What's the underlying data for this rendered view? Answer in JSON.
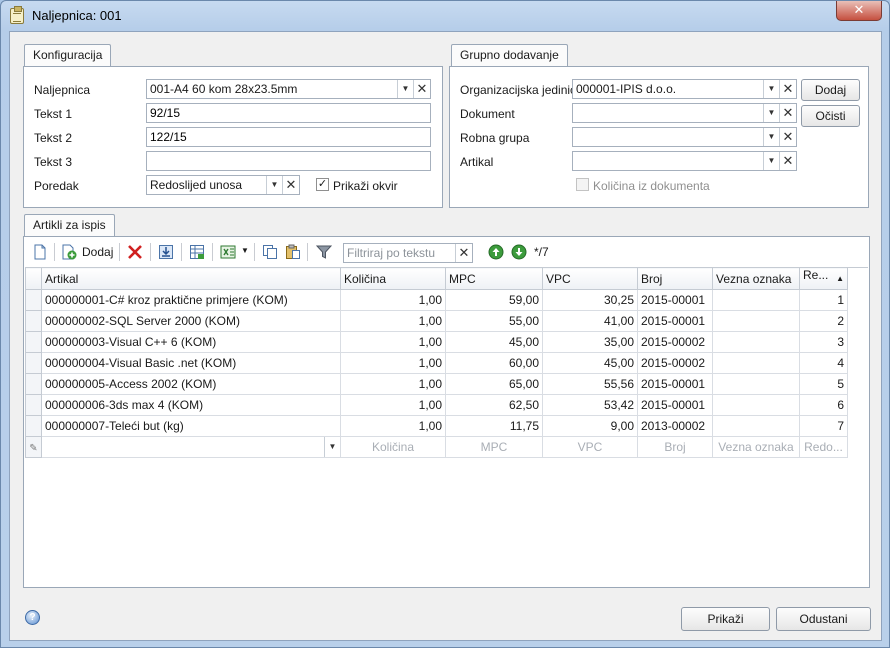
{
  "window": {
    "title": "Naljepnica: 001",
    "close_symbol": "✕"
  },
  "config": {
    "tab_label": "Konfiguracija",
    "naljepnica_label": "Naljepnica",
    "naljepnica_value": "001-A4 60 kom 28x23.5mm",
    "tekst1_label": "Tekst 1",
    "tekst1_value": "92/15",
    "tekst2_label": "Tekst 2",
    "tekst2_value": "122/15",
    "tekst3_label": "Tekst 3",
    "tekst3_value": "",
    "poredak_label": "Poredak",
    "poredak_value": "Redoslijed unosa",
    "prikazi_okvir_label": "Prikaži okvir",
    "prikazi_okvir_checked": true
  },
  "group": {
    "tab_label": "Grupno dodavanje",
    "org_label": "Organizacijska jedinica",
    "org_value": "000001-IPIS d.o.o.",
    "dokument_label": "Dokument",
    "dokument_value": "",
    "robna_label": "Robna grupa",
    "robna_value": "",
    "artikal_label": "Artikal",
    "artikal_value": "",
    "dodaj_label": "Dodaj",
    "ocisti_label": "Očisti",
    "kolicina_dok_label": "Količina iz dokumenta",
    "kolicina_dok_checked": false
  },
  "items": {
    "tab_label": "Artikli za ispis",
    "dodaj_label": "Dodaj",
    "filter_placeholder": "Filtriraj po tekstu",
    "count_label": "*/7",
    "columns": [
      "Artikal",
      "Količina",
      "MPC",
      "VPC",
      "Broj",
      "Vezna oznaka",
      "Re..."
    ],
    "sort_indicator": "▲",
    "rows": [
      [
        "000000001-C# kroz praktične primjere (KOM)",
        "1,00",
        "59,00",
        "30,25",
        "2015-00001",
        "",
        "1"
      ],
      [
        "000000002-SQL Server 2000 (KOM)",
        "1,00",
        "55,00",
        "41,00",
        "2015-00001",
        "",
        "2"
      ],
      [
        "000000003-Visual C++ 6 (KOM)",
        "1,00",
        "45,00",
        "35,00",
        "2015-00002",
        "",
        "3"
      ],
      [
        "000000004-Visual Basic .net (KOM)",
        "1,00",
        "60,00",
        "45,00",
        "2015-00002",
        "",
        "4"
      ],
      [
        "000000005-Access 2002 (KOM)",
        "1,00",
        "65,00",
        "55,56",
        "2015-00001",
        "",
        "5"
      ],
      [
        "000000006-3ds max 4 (KOM)",
        "1,00",
        "62,50",
        "53,42",
        "2015-00001",
        "",
        "6"
      ],
      [
        "000000007-Teleći but (kg)",
        "1,00",
        "11,75",
        "9,00",
        "2013-00002",
        "",
        "7"
      ]
    ],
    "new_row_placeholders": [
      "Količina",
      "MPC",
      "VPC",
      "Broj",
      "Vezna oznaka",
      "Redo..."
    ]
  },
  "footer": {
    "help_symbol": "?",
    "prikazi_label": "Prikaži",
    "odustani_label": "Odustani"
  }
}
